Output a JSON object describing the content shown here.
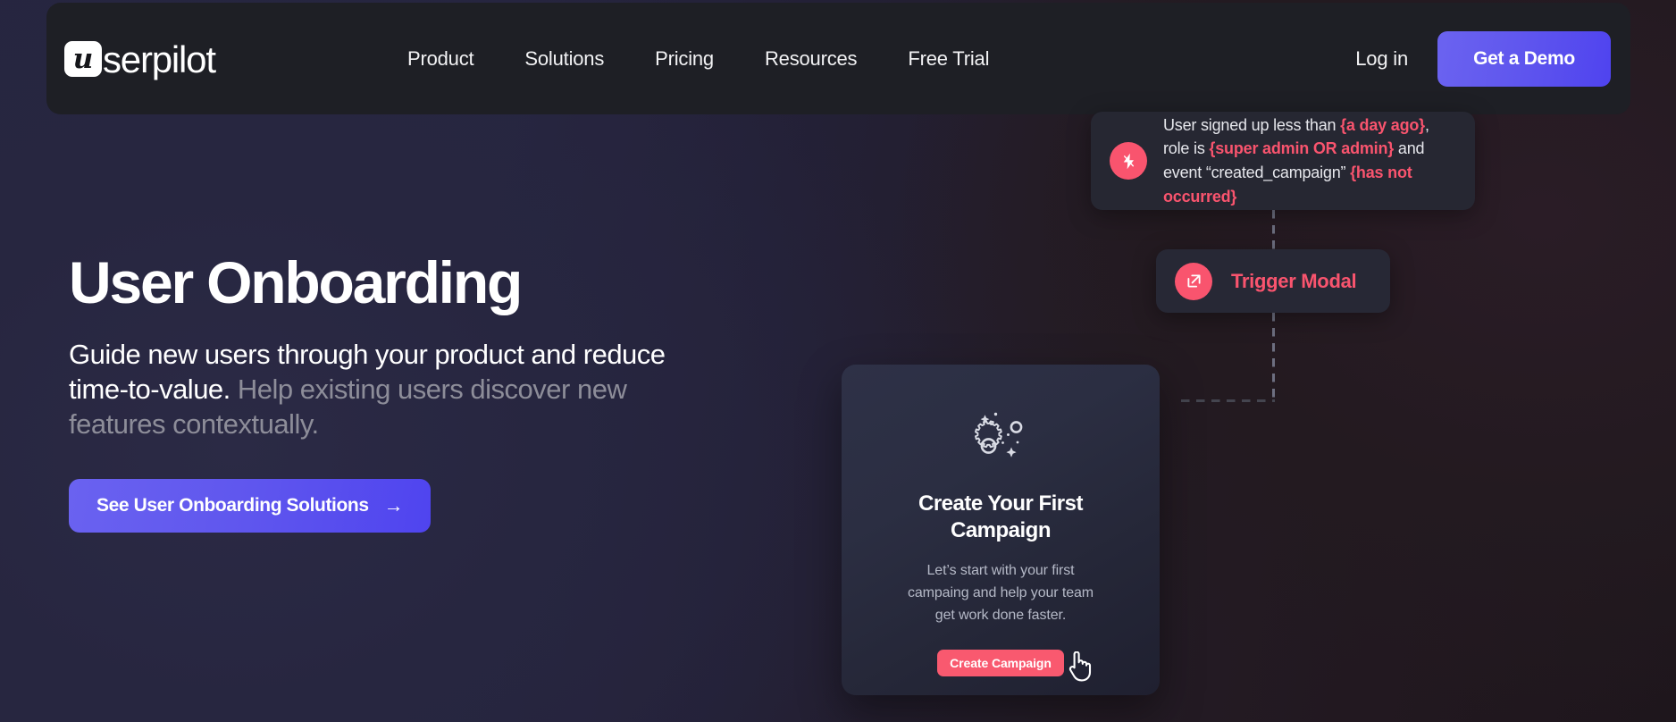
{
  "brand": {
    "mark_letter": "u",
    "word": "serpilot",
    "full_name": "userpilot"
  },
  "nav": {
    "links": [
      {
        "label": "Product"
      },
      {
        "label": "Solutions"
      },
      {
        "label": "Pricing"
      },
      {
        "label": "Resources"
      },
      {
        "label": "Free Trial"
      }
    ],
    "login_label": "Log in",
    "demo_label": "Get a Demo"
  },
  "hero": {
    "title": "User Onboarding",
    "subtitle_bright": "Guide new users through your product and reduce time-to-value.",
    "subtitle_dim": " Help existing users discover new features contextually.",
    "cta_label": "See User Onboarding Solutions",
    "cta_arrow": "→"
  },
  "flow": {
    "condition_card": {
      "icon": "lightning-bolt-icon",
      "segments": [
        {
          "text": "User signed up less than ",
          "accent": false
        },
        {
          "text": "{a day ago}",
          "accent": true
        },
        {
          "text": ", role is ",
          "accent": false
        },
        {
          "text": "{super admin OR admin}",
          "accent": true
        },
        {
          "text": " and event “created_campaign” ",
          "accent": false
        },
        {
          "text": "{has not occurred}",
          "accent": true
        }
      ],
      "plain_text": "User signed up less than {a day ago}, role is {super admin OR admin} and event “created_campaign” {has not occurred}"
    },
    "trigger_node": {
      "icon": "external-link-icon",
      "label": "Trigger Modal"
    }
  },
  "modal_preview": {
    "icon": "gears-sparkle-icon",
    "title": "Create Your First Campaign",
    "body": "Let’s start with your first campaing and help your team get work done faster.",
    "cta_label": "Create Campaign",
    "cursor_icon": "pointing-hand-cursor-icon"
  },
  "colors": {
    "accent_purple": "#5f56ee",
    "accent_pink": "#f9546e",
    "nav_background": "#1e1f25",
    "page_background_left": "#272640",
    "page_background_right": "#231a20",
    "text_primary": "#ffffff",
    "text_muted": "#8d8d99"
  }
}
